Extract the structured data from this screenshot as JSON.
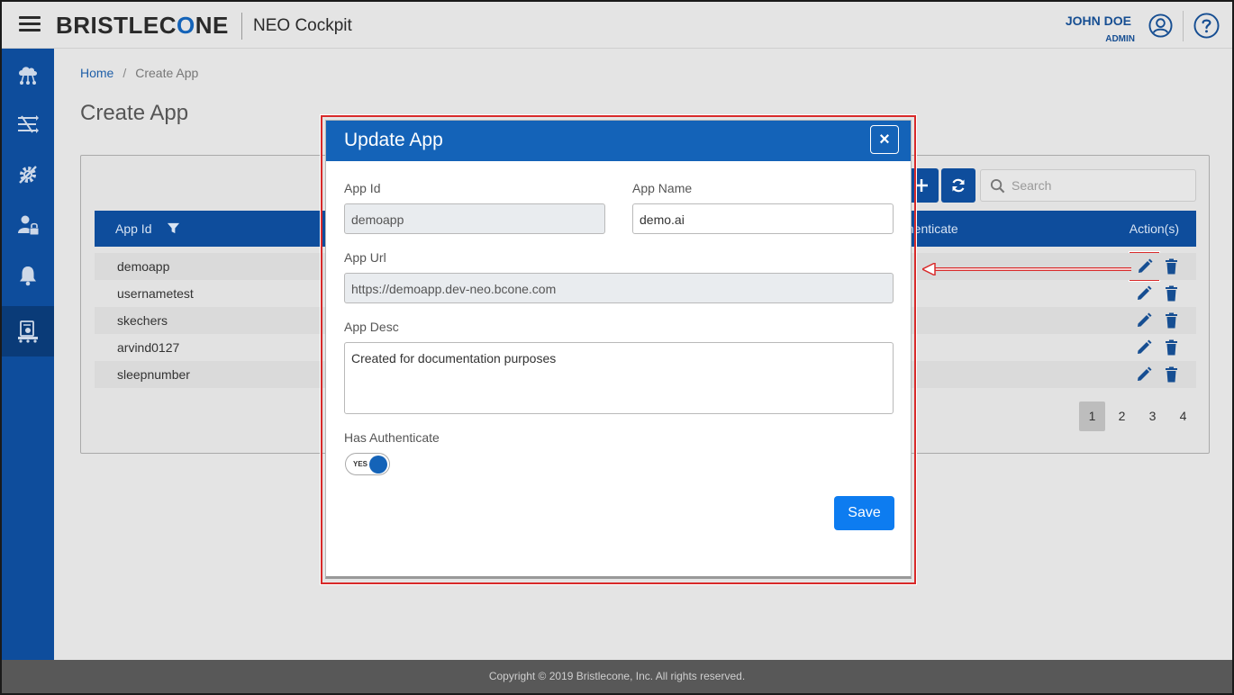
{
  "header": {
    "logo_pre": "BRISTLEC",
    "logo_o": "O",
    "logo_post": "NE",
    "app_title": "NEO Cockpit",
    "user_name": "JOHN DOE",
    "user_role": "ADMIN"
  },
  "sidebar": {
    "items": [
      {
        "icon": "cloud-network-icon"
      },
      {
        "icon": "transform-arrows-icon"
      },
      {
        "icon": "gear-tools-icon"
      },
      {
        "icon": "user-lock-icon"
      },
      {
        "icon": "bell-icon"
      },
      {
        "icon": "app-document-icon",
        "active": true
      }
    ]
  },
  "breadcrumb": {
    "home": "Home",
    "separator": "/",
    "current": "Create App"
  },
  "page": {
    "title": "Create App"
  },
  "search": {
    "placeholder": "Search"
  },
  "table": {
    "columns": {
      "app_id": "App Id",
      "authenticate": "thenticate",
      "actions": "Action(s)"
    },
    "rows": [
      {
        "app_id": "demoapp"
      },
      {
        "app_id": "usernametest"
      },
      {
        "app_id": "skechers"
      },
      {
        "app_id": "arvind0127"
      },
      {
        "app_id": "sleepnumber"
      }
    ]
  },
  "pagination": {
    "pages": [
      "1",
      "2",
      "3",
      "4"
    ],
    "current": "1"
  },
  "modal": {
    "title": "Update App",
    "close_label": "×",
    "app_id_label": "App Id",
    "app_id_value": "demoapp",
    "app_name_label": "App Name",
    "app_name_value": "demo.ai",
    "app_url_label": "App Url",
    "app_url_value": "https://demoapp.dev-neo.bcone.com",
    "app_desc_label": "App Desc",
    "app_desc_value": "Created for documentation purposes",
    "has_auth_label": "Has Authenticate",
    "toggle_text": "YES",
    "save_label": "Save"
  },
  "footer": {
    "copyright": "Copyright © 2019 Bristlecone, Inc. All rights reserved."
  },
  "colors": {
    "brand_blue": "#0e4d9c",
    "header_blue": "#1463b8",
    "save_blue": "#0d7cf0",
    "highlight_red": "#d82a2a"
  }
}
